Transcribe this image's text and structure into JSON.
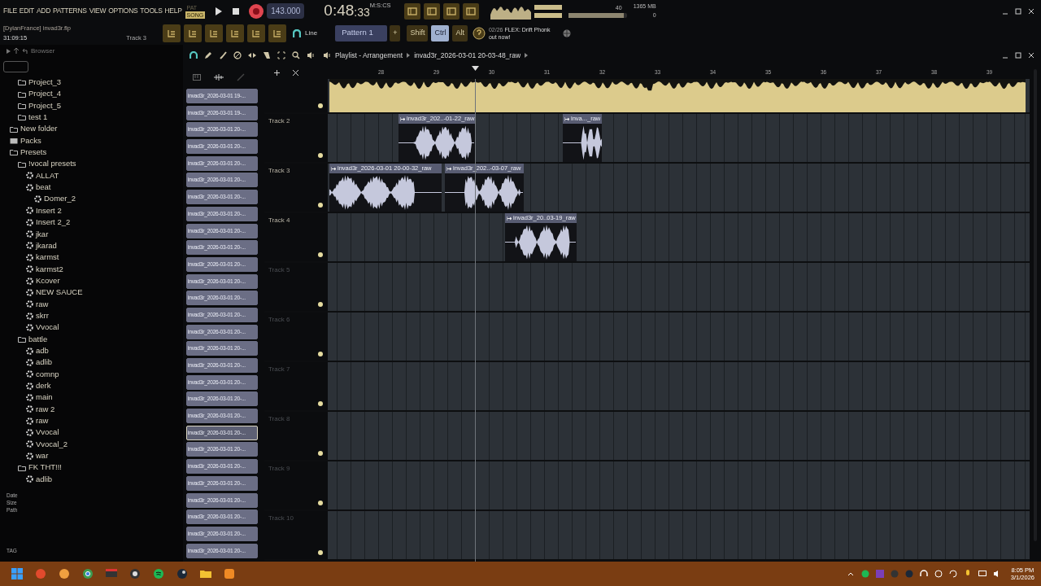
{
  "menu": [
    "FILE",
    "EDIT",
    "ADD",
    "PATTERNS",
    "VIEW",
    "OPTIONS",
    "TOOLS",
    "HELP"
  ],
  "mode_toggle": [
    {
      "label": "PAT",
      "selected": false
    },
    {
      "label": "SONG",
      "selected": true
    }
  ],
  "transport": {
    "recording": true,
    "tempo": "143.000",
    "time": "0:48",
    "time_fraction": ":33",
    "time_format": "M:S:CS"
  },
  "monitor": {
    "master": {
      "value": "40",
      "level": 0.95
    },
    "memory": "1365 MB",
    "polyphony": "0"
  },
  "project": {
    "title": "[DylanFrance] invad3r.flp",
    "time": "31:09:15",
    "track": "Track 3"
  },
  "snap": {
    "label": "Line"
  },
  "pattern": {
    "label": "Pattern 1",
    "add": "+"
  },
  "modifiers": [
    {
      "label": "Shift",
      "selected": false
    },
    {
      "label": "Ctrl",
      "selected": true
    },
    {
      "label": "Alt",
      "selected": false
    }
  ],
  "news": {
    "date": "02/26",
    "text": "FLEX: Drift Phonk",
    "text_line2": "out now!"
  },
  "browser": {
    "title": "Browser",
    "tree": {
      "continued_children": [
        {
          "label": "Project_3",
          "kind": "folder"
        },
        {
          "label": "Project_4",
          "kind": "folder"
        },
        {
          "label": "Project_5",
          "kind": "folder"
        },
        {
          "label": "test 1",
          "kind": "folder"
        }
      ],
      "items": [
        {
          "label": "New folder",
          "kind": "folder"
        },
        {
          "label": "Packs",
          "kind": "pack"
        },
        {
          "label": "Presets",
          "kind": "folder",
          "children": [
            {
              "label": "!vocal presets",
              "kind": "folder",
              "children": [
                {
                  "label": "ALLAT",
                  "kind": "preset"
                },
                {
                  "label": "beat",
                  "kind": "preset",
                  "children": [
                    {
                      "label": "Domer_2",
                      "kind": "preset"
                    }
                  ]
                },
                {
                  "label": "Insert 2",
                  "kind": "preset"
                },
                {
                  "label": "Insert 2_2",
                  "kind": "preset"
                },
                {
                  "label": "jkar",
                  "kind": "preset"
                },
                {
                  "label": "jkarad",
                  "kind": "preset"
                },
                {
                  "label": "karmst",
                  "kind": "preset"
                },
                {
                  "label": "karmst2",
                  "kind": "preset"
                },
                {
                  "label": "Kcover",
                  "kind": "preset"
                },
                {
                  "label": "NEW SAUCE",
                  "kind": "preset"
                },
                {
                  "label": "raw",
                  "kind": "preset"
                },
                {
                  "label": "skrr",
                  "kind": "preset"
                },
                {
                  "label": "Vvocal",
                  "kind": "preset"
                }
              ]
            },
            {
              "label": "battle",
              "kind": "folder",
              "children": [
                {
                  "label": "adb",
                  "kind": "preset"
                },
                {
                  "label": "adlib",
                  "kind": "preset"
                },
                {
                  "label": "comnp",
                  "kind": "preset"
                },
                {
                  "label": "derk",
                  "kind": "preset"
                },
                {
                  "label": "main",
                  "kind": "preset"
                },
                {
                  "label": "raw 2",
                  "kind": "preset"
                },
                {
                  "label": "raw",
                  "kind": "preset"
                },
                {
                  "label": "Vvocal",
                  "kind": "preset"
                },
                {
                  "label": "Vvocal_2",
                  "kind": "preset"
                },
                {
                  "label": "war",
                  "kind": "preset"
                }
              ]
            },
            {
              "label": "FK THT!!!",
              "kind": "folder",
              "children": [
                {
                  "label": "adlib",
                  "kind": "preset"
                }
              ]
            }
          ]
        }
      ]
    },
    "info_labels": [
      "Date",
      "Size",
      "Path"
    ],
    "tag_label": "TAG"
  },
  "playlist": {
    "title": "Playlist - Arrangement",
    "breadcrumb": "invad3r_2026-03-01 20-03-48_raw",
    "clip_list": [
      {
        "label": "invad3r_2026-03-01 19-...",
        "selected": false
      },
      {
        "label": "invad3r_2026-03-01 19-...",
        "selected": false
      },
      {
        "label": "invad3r_2026-03-01 20-...",
        "selected": false
      },
      {
        "label": "invad3r_2026-03-01 20-...",
        "selected": false
      },
      {
        "label": "invad3r_2026-03-01 20-...",
        "selected": false
      },
      {
        "label": "invad3r_2026-03-01 20-...",
        "selected": false
      },
      {
        "label": "invad3r_2026-03-01 20-...",
        "selected": false
      },
      {
        "label": "invad3r_2026-03-01 20-...",
        "selected": false
      },
      {
        "label": "invad3r_2026-03-01 20-...",
        "selected": false
      },
      {
        "label": "invad3r_2026-03-01 20-...",
        "selected": false
      },
      {
        "label": "invad3r_2026-03-01 20-...",
        "selected": false
      },
      {
        "label": "invad3r_2026-03-01 20-...",
        "selected": false
      },
      {
        "label": "invad3r_2026-03-01 20-...",
        "selected": false
      },
      {
        "label": "invad3r_2026-03-01 20-...",
        "selected": false
      },
      {
        "label": "invad3r_2026-03-01 20-...",
        "selected": false
      },
      {
        "label": "invad3r_2026-03-01 20-...",
        "selected": false
      },
      {
        "label": "invad3r_2026-03-01 20-...",
        "selected": false
      },
      {
        "label": "invad3r_2026-03-01 20-...",
        "selected": false
      },
      {
        "label": "invad3r_2026-03-01 20-...",
        "selected": false
      },
      {
        "label": "invad3r_2026-03-01 20-...",
        "selected": false
      },
      {
        "label": "invad3r_2026-03-01 20-...",
        "selected": true
      },
      {
        "label": "invad3r_2026-03-01 20-...",
        "selected": false
      },
      {
        "label": "invad3r_2026-03-01 20-...",
        "selected": false
      },
      {
        "label": "invad3r_2026-03-01 20-...",
        "selected": false
      },
      {
        "label": "invad3r_2026-03-01 20-...",
        "selected": false
      },
      {
        "label": "invad3r_2026-03-01 20-...",
        "selected": false
      },
      {
        "label": "invad3r_2026-03-01 20-...",
        "selected": false
      },
      {
        "label": "invad3r_2026-03-01 20-...",
        "selected": false
      }
    ],
    "ruler": [
      "28",
      "29",
      "30",
      "31",
      "32",
      "33",
      "34",
      "35",
      "36",
      "37",
      "38",
      "39"
    ],
    "tracks": [
      {
        "clips": [
          {
            "kind": "body"
          }
        ]
      },
      {
        "label": "Track 2",
        "clips": [
          {
            "kind": "clip",
            "title": "invad3r_202..-01-22_raw"
          },
          {
            "kind": "clip",
            "title": "inva..._raw"
          }
        ]
      },
      {
        "label": "Track 3",
        "clips": [
          {
            "kind": "clip",
            "title": "invad3r_2026-03-01 20-00-32_raw"
          },
          {
            "kind": "clip",
            "title": "invad3r_202..-03-07_raw"
          }
        ]
      },
      {
        "label": "Track 4",
        "clips": [
          {
            "kind": "clip",
            "title": "invad3r_20..03-19_raw"
          }
        ]
      },
      {
        "label": "Track 5"
      },
      {
        "label": "Track 6"
      },
      {
        "label": "Track 7"
      },
      {
        "label": "Track 8"
      },
      {
        "label": "Track 9"
      },
      {
        "label": "Track 10"
      }
    ]
  },
  "taskbar": {
    "time": "8:05 PM",
    "date": "3/1/2026"
  }
}
